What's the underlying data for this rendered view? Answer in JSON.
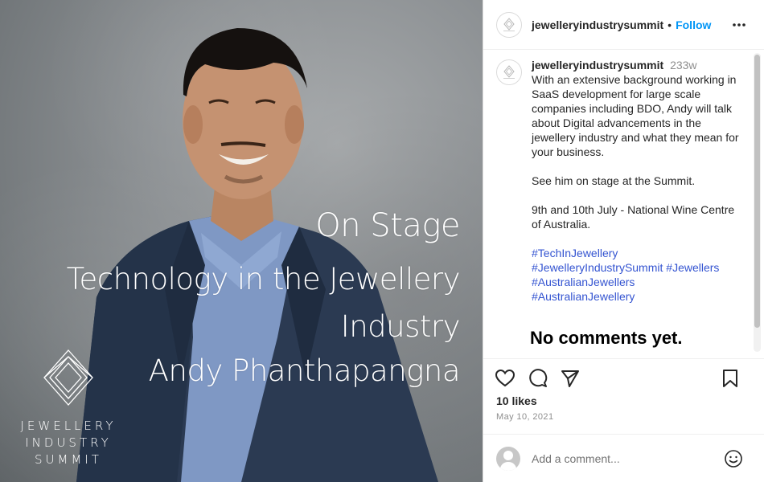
{
  "photo": {
    "overlay": {
      "line1": "On Stage",
      "line2": "Technology in the Jewellery",
      "line3": "Industry",
      "line4": "Andy Phanthapangna"
    },
    "logo_lines": [
      "JEWELLERY",
      "INDUSTRY",
      "SUMMIT"
    ]
  },
  "header": {
    "username": "jewelleryindustrysummit",
    "separator": "•",
    "follow_label": "Follow",
    "more_icon": "more-horizontal-icon"
  },
  "caption": {
    "username": "jewelleryindustrysummit",
    "time": "233w",
    "text": "With an extensive background working in SaaS development for large scale companies including BDO, Andy will talk about Digital advancements in the jewellery industry and what they mean for your business.\n\nSee him on stage at the Summit.\n\n9th and 10th July - National Wine Centre of Australia.",
    "hashtags": [
      "#TechInJewellery",
      "#JewelleryIndustrySummit",
      "#Jewellers",
      "#AustralianJewellers",
      "#AustralianJewellery"
    ]
  },
  "comments": {
    "empty_text": "No comments yet."
  },
  "actions": {
    "icons": [
      "heart-icon",
      "comment-icon",
      "share-icon",
      "bookmark-icon"
    ],
    "likes": "10 likes",
    "date": "May 10, 2021"
  },
  "add_comment": {
    "placeholder": "Add a comment...",
    "emoji_icon": "emoji-icon"
  },
  "colors": {
    "follow": "#0095f6",
    "hashtag": "#3454d1",
    "text": "#262626",
    "muted": "#8e8e8e"
  }
}
